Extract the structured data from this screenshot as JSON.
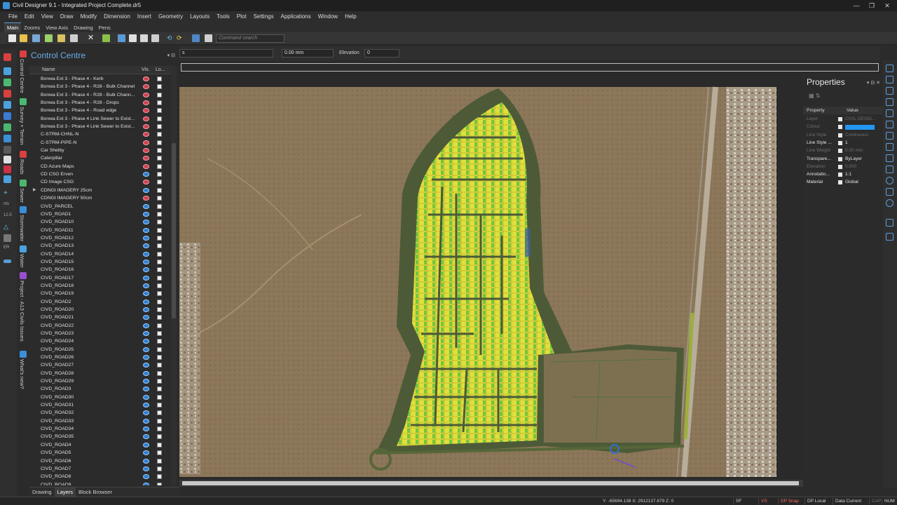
{
  "window": {
    "title": "Civil Designer 9.1 - Integrated Project Complete.dr5",
    "controls": [
      "—",
      "❐",
      "✕"
    ]
  },
  "menu": [
    "File",
    "Edit",
    "View",
    "Draw",
    "Modify",
    "Dimension",
    "Insert",
    "Geometry",
    "Layouts",
    "Tools",
    "Plot",
    "Settings",
    "Applications",
    "Window",
    "Help"
  ],
  "ribbon_tabs": [
    "Main",
    "Zooms",
    "View Axis",
    "Drawing",
    "Pens"
  ],
  "toolbar": {
    "command_search_placeholder": "Command search"
  },
  "vertical_tabs": [
    "Control Centre",
    "Survey + Terrain",
    "Roads",
    "Sewer",
    "Stormwater",
    "Water",
    "Project - A13 Civils Issues",
    "What's new?"
  ],
  "control_centre": {
    "title": "Control Centre",
    "columns": {
      "name": "Name",
      "vis": "Vis.",
      "lock": "Lo..."
    },
    "layers": [
      {
        "name": "Bonwa Ext 3 - Phase 4 - Kerb",
        "vis": "off"
      },
      {
        "name": "Bonwa Ext 3 - Phase 4 - R28 - Bulk Channel",
        "vis": "off"
      },
      {
        "name": "Bonwa Ext 3 - Phase 4 - R28 - Bulk Chann...",
        "vis": "off"
      },
      {
        "name": "Bonwa Ext 3 - Phase 4 - R28 - Drops",
        "vis": "off"
      },
      {
        "name": "Bonwa Ext 3 - Phase 4 - Road edge",
        "vis": "off"
      },
      {
        "name": "Bonwa Ext 3 - Phase 4 Link Sewer to Exist...",
        "vis": "off"
      },
      {
        "name": "Bonwa Ext 3 - Phase 4 Link Sewer to Exist...",
        "vis": "off"
      },
      {
        "name": "C-STRM-CHNL-N",
        "vis": "off"
      },
      {
        "name": "C-STRM-PIPE-N",
        "vis": "off"
      },
      {
        "name": "Car Shelby",
        "vis": "off"
      },
      {
        "name": "Caterpillar",
        "vis": "off"
      },
      {
        "name": "CD Azure Maps",
        "vis": "off"
      },
      {
        "name": "CD CSG Erven",
        "vis": "on"
      },
      {
        "name": "CD Image CSG",
        "vis": "off"
      },
      {
        "name": "CDNGI IMAGERY 25cm",
        "vis": "on",
        "expandable": true
      },
      {
        "name": "CDNGI IMAGERY 50cm",
        "vis": "off"
      },
      {
        "name": "CIVD_PARCEL",
        "vis": "on"
      },
      {
        "name": "CIVD_ROAD1",
        "vis": "on"
      },
      {
        "name": "CIVD_ROAD10",
        "vis": "on"
      },
      {
        "name": "CIVD_ROAD11",
        "vis": "on"
      },
      {
        "name": "CIVD_ROAD12",
        "vis": "on"
      },
      {
        "name": "CIVD_ROAD13",
        "vis": "on"
      },
      {
        "name": "CIVD_ROAD14",
        "vis": "on"
      },
      {
        "name": "CIVD_ROAD15",
        "vis": "on"
      },
      {
        "name": "CIVD_ROAD16",
        "vis": "on"
      },
      {
        "name": "CIVD_ROAD17",
        "vis": "on"
      },
      {
        "name": "CIVD_ROAD18",
        "vis": "on"
      },
      {
        "name": "CIVD_ROAD19",
        "vis": "on"
      },
      {
        "name": "CIVD_ROAD2",
        "vis": "on"
      },
      {
        "name": "CIVD_ROAD20",
        "vis": "on"
      },
      {
        "name": "CIVD_ROAD21",
        "vis": "on"
      },
      {
        "name": "CIVD_ROAD22",
        "vis": "on"
      },
      {
        "name": "CIVD_ROAD23",
        "vis": "on"
      },
      {
        "name": "CIVD_ROAD24",
        "vis": "on"
      },
      {
        "name": "CIVD_ROAD25",
        "vis": "on"
      },
      {
        "name": "CIVD_ROAD26",
        "vis": "on"
      },
      {
        "name": "CIVD_ROAD27",
        "vis": "on"
      },
      {
        "name": "CIVD_ROAD28",
        "vis": "on"
      },
      {
        "name": "CIVD_ROAD29",
        "vis": "on"
      },
      {
        "name": "CIVD_ROAD3",
        "vis": "on"
      },
      {
        "name": "CIVD_ROAD30",
        "vis": "on"
      },
      {
        "name": "CIVD_ROAD31",
        "vis": "on"
      },
      {
        "name": "CIVD_ROAD32",
        "vis": "on"
      },
      {
        "name": "CIVD_ROAD33",
        "vis": "on"
      },
      {
        "name": "CIVD_ROAD34",
        "vis": "on"
      },
      {
        "name": "CIVD_ROAD35",
        "vis": "on"
      },
      {
        "name": "CIVD_ROAD4",
        "vis": "on"
      },
      {
        "name": "CIVD_ROAD5",
        "vis": "on"
      },
      {
        "name": "CIVD_ROAD6",
        "vis": "on"
      },
      {
        "name": "CIVD_ROAD7",
        "vis": "on"
      },
      {
        "name": "CIVD_ROAD8",
        "vis": "on"
      },
      {
        "name": "CIVD_ROAD9",
        "vis": "on"
      }
    ],
    "bottom_tabs": [
      "Drawing",
      "Layers",
      "Block Browser"
    ]
  },
  "property_bar": {
    "layer_value": "s",
    "lineweight_value": "0.00 mm",
    "elevation_label": "Elevation",
    "elevation_value": "0"
  },
  "properties": {
    "title": "Properties",
    "columns": {
      "property": "Property",
      "value": "Value"
    },
    "rows": [
      {
        "key": "Layer",
        "value": "CIVIL DESIG...",
        "dim": true
      },
      {
        "key": "Colour",
        "value": "",
        "dim": true,
        "swatch": "#2196f3"
      },
      {
        "key": "Line Style",
        "value": "Continuous",
        "dim": true
      },
      {
        "key": "Line Style ...",
        "value": "1",
        "dim": false
      },
      {
        "key": "Line Weight",
        "value": "0.00 mm",
        "dim": true
      },
      {
        "key": "Transpare...",
        "value": "ByLayer",
        "dim": false
      },
      {
        "key": "Elevation",
        "value": "0.000",
        "dim": true
      },
      {
        "key": "Annotatio...",
        "value": "1:1",
        "dim": false
      },
      {
        "key": "Material",
        "value": "Global",
        "dim": false
      }
    ]
  },
  "status": {
    "coords": "Y: -65694.138 X: 2912137.679 Z: 0",
    "buttons": [
      {
        "label": "SF",
        "color": "normal"
      },
      {
        "label": "VS",
        "color": "red"
      },
      {
        "label": "DP Snap",
        "color": "red"
      },
      {
        "label": "DP Local",
        "color": "normal"
      },
      {
        "label": "Data Current",
        "color": "normal"
      },
      {
        "label": "CAP",
        "color": "dim"
      },
      {
        "label": "NUM",
        "color": "normal"
      }
    ]
  },
  "colors": {
    "accent": "#5b9bd5",
    "plot_yellow": "#e7e23a",
    "plot_green": "#69c43c",
    "road": "#4c5a3a",
    "terrain": "#8a7558"
  }
}
